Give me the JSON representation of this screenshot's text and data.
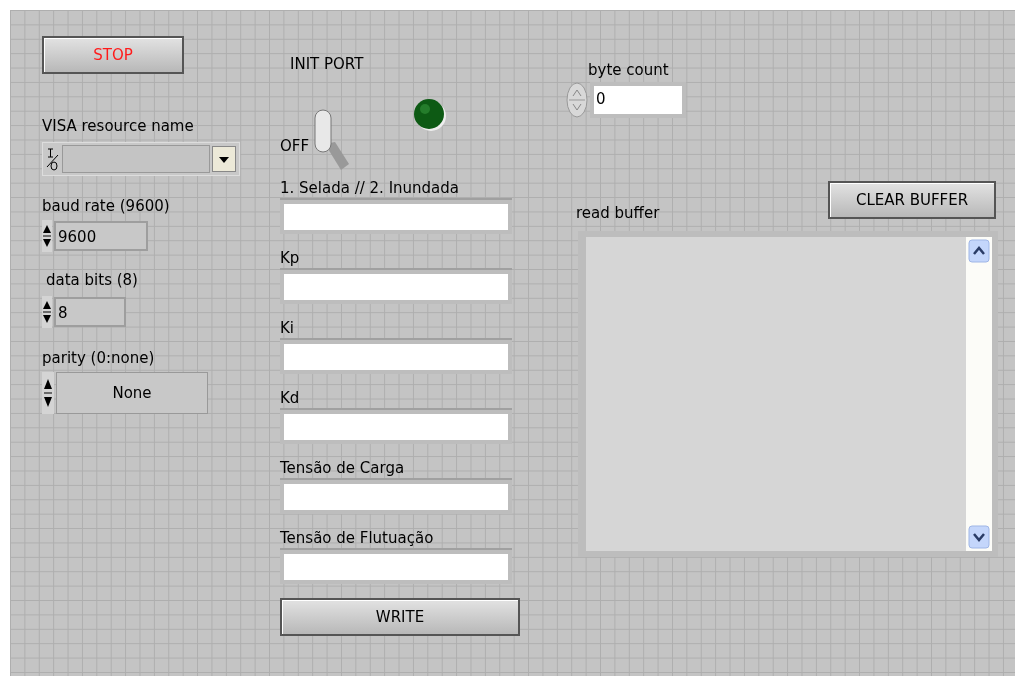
{
  "stop_button": {
    "label": "STOP"
  },
  "visa_resource": {
    "label": "VISA resource name"
  },
  "baud_rate": {
    "label": "baud rate (9600)",
    "value": "9600"
  },
  "data_bits": {
    "label": "data bits (8)",
    "value": "8"
  },
  "parity": {
    "label": "parity (0:none)",
    "value": "None"
  },
  "init_port": {
    "label": "INIT PORT",
    "switch_text": "OFF",
    "on": false
  },
  "led": {
    "on": false
  },
  "string_inputs": [
    {
      "label": "1. Selada // 2. Inundada"
    },
    {
      "label": "Kp"
    },
    {
      "label": "Ki"
    },
    {
      "label": "Kd"
    },
    {
      "label": "Tensão de Carga"
    },
    {
      "label": "Tensão de Flutuação"
    }
  ],
  "write_button": {
    "label": "WRITE"
  },
  "byte_count": {
    "label": "byte count",
    "value": "0"
  },
  "clear_buffer_button": {
    "label": "CLEAR BUFFER"
  },
  "read_buffer": {
    "label": "read buffer"
  }
}
